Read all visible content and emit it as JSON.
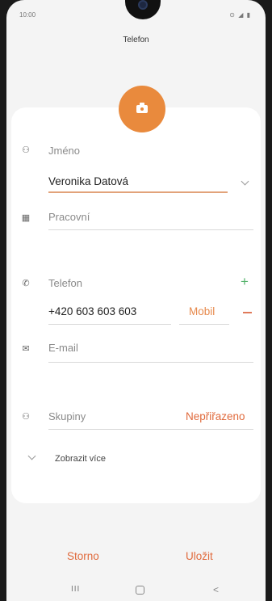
{
  "status": {
    "time": "10:00",
    "icons": "⊙ ◢ ▮"
  },
  "header": {
    "title": "Telefon"
  },
  "photo": {
    "icon": "camera-icon"
  },
  "name": {
    "label": "Jméno",
    "value": "Veronika Datová",
    "icon": "person-icon"
  },
  "company": {
    "placeholder": "Pracovní",
    "icon": "building-icon"
  },
  "phone": {
    "label": "Telefon",
    "value": "+420 603 603 603",
    "type": "Mobil",
    "add": "+",
    "icon": "phone-icon"
  },
  "email": {
    "placeholder": "E-mail",
    "icon": "mail-icon"
  },
  "groups": {
    "label": "Skupiny",
    "value": "Nepřiřazeno",
    "icon": "people-icon"
  },
  "more": {
    "label": "Zobrazit více"
  },
  "actions": {
    "cancel": "Storno",
    "save": "Uložit"
  },
  "nav": {
    "recents": "III",
    "back": "<"
  },
  "colors": {
    "accent": "#e98a3d",
    "add": "#55b36b",
    "remove": "#e07a5a",
    "action": "#e06a3c"
  }
}
